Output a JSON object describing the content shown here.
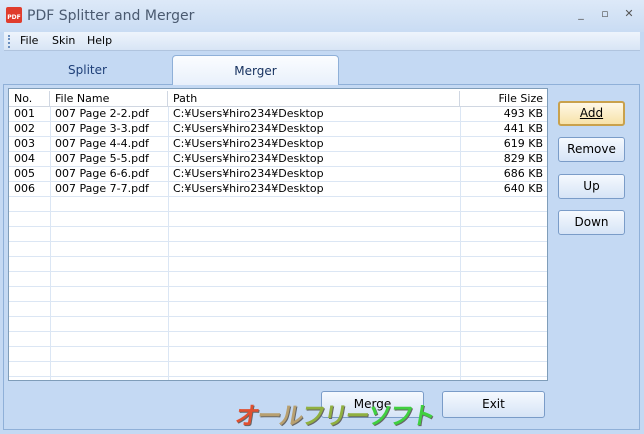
{
  "window": {
    "title": "PDF Splitter and Merger",
    "icon": "pdf-scissors-icon"
  },
  "menu": [
    {
      "label": "File",
      "key": "F"
    },
    {
      "label": "Skin",
      "key": "S"
    },
    {
      "label": "Help",
      "key": "H"
    }
  ],
  "tabs": [
    {
      "label": "Spliter",
      "active": false
    },
    {
      "label": "Merger",
      "active": true
    }
  ],
  "table": {
    "columns": [
      "No.",
      "File Name",
      "Path",
      "File Size"
    ],
    "rows": [
      [
        "001",
        "007 Page 2-2.pdf",
        "C:¥Users¥hiro234¥Desktop",
        "493 KB"
      ],
      [
        "002",
        "007 Page 3-3.pdf",
        "C:¥Users¥hiro234¥Desktop",
        "441 KB"
      ],
      [
        "003",
        "007 Page 4-4.pdf",
        "C:¥Users¥hiro234¥Desktop",
        "619 KB"
      ],
      [
        "004",
        "007 Page 5-5.pdf",
        "C:¥Users¥hiro234¥Desktop",
        "829 KB"
      ],
      [
        "005",
        "007 Page 6-6.pdf",
        "C:¥Users¥hiro234¥Desktop",
        "686 KB"
      ],
      [
        "006",
        "007 Page 7-7.pdf",
        "C:¥Users¥hiro234¥Desktop",
        "640 KB"
      ]
    ]
  },
  "side_buttons": {
    "add": "Add",
    "remove": "Remove",
    "up": "Up",
    "down": "Down"
  },
  "bottom_buttons": {
    "merge": "Merge",
    "exit": "Exit"
  },
  "watermark": "オールフリーソフト"
}
